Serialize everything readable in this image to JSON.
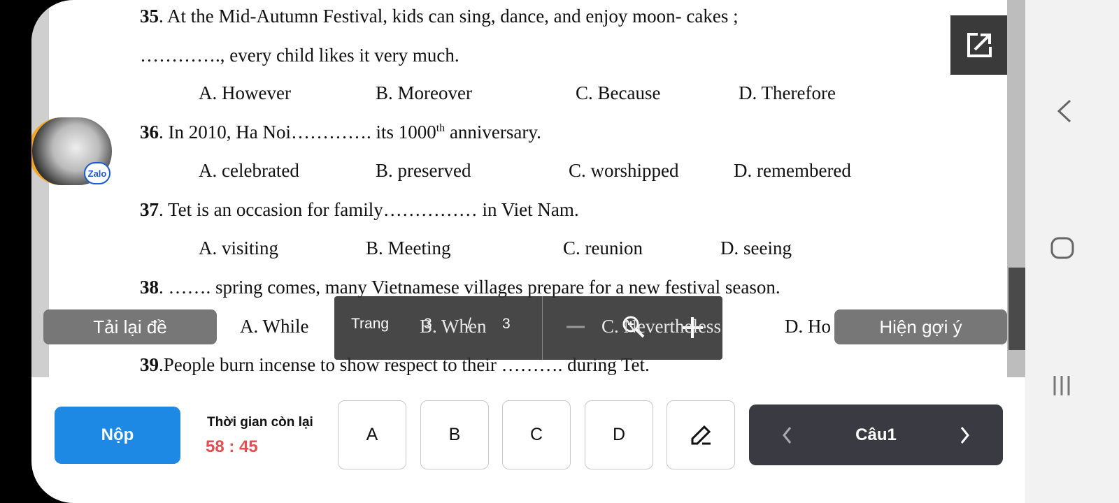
{
  "questions": [
    {
      "num": "35",
      "text": ". At the Mid-Autumn Festival, kids can sing, dance, and enjoy moon- cakes ;",
      "text2": "…………., every child likes it very much.",
      "options": [
        "A. However",
        "B. Moreover",
        "C. Because",
        "D. Therefore"
      ]
    },
    {
      "num": "36",
      "text": ". In 2010, Ha Noi…………. its 1000",
      "sup": "th",
      "text_after": " anniversary.",
      "options": [
        "A. celebrated",
        "B. preserved",
        "C. worshipped",
        "D. remembered"
      ]
    },
    {
      "num": "37",
      "text": ". Tet is an occasion for family…………… in Viet Nam.",
      "options": [
        "A. visiting",
        "B. Meeting",
        "C. reunion",
        "D. seeing"
      ]
    },
    {
      "num": "38",
      "text": ". ……. spring comes, many Vietnamese villages prepare for a new festival season.",
      "options": [
        "A. While",
        "B. When",
        "C. Nevertheless",
        "D. Ho"
      ]
    },
    {
      "num": "39",
      "text": ".People burn incense to show respect to their ………. during Tet."
    }
  ],
  "pager": {
    "label": "Trang",
    "current": "3",
    "separator": "/",
    "total": "3"
  },
  "buttons": {
    "reload": "Tải lại đề",
    "hint": "Hiện gợi ý",
    "submit": "Nộp"
  },
  "timer": {
    "label": "Thời gian còn lại",
    "value": "58 : 45"
  },
  "answers": [
    "A",
    "B",
    "C",
    "D"
  ],
  "nav": {
    "label": "Câu1"
  },
  "zalo": {
    "badge": "Zalo"
  },
  "colors": {
    "submit": "#1e88e5",
    "timer": "#e05050",
    "nav": "#3a3b42",
    "gray_button": "#777777"
  }
}
